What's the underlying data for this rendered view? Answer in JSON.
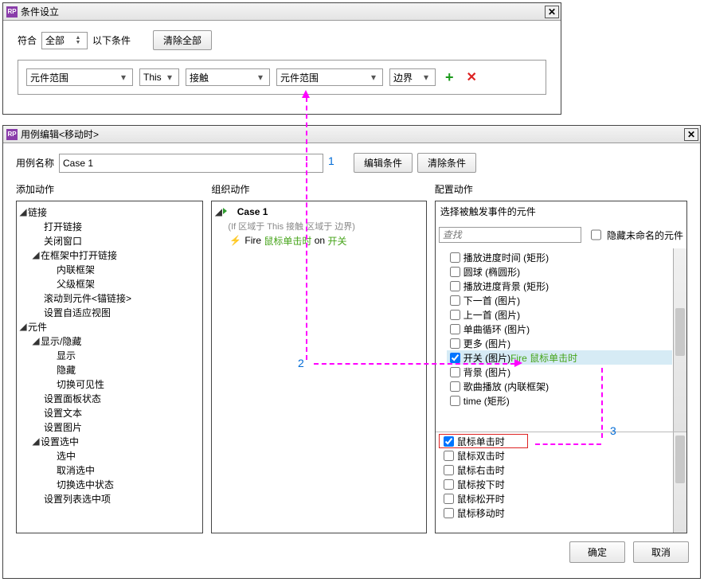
{
  "dlg1": {
    "title": "条件设立",
    "match_label": "符合",
    "match_combo": "全部",
    "match_suffix": "以下条件",
    "clear_all": "清除全部",
    "row": {
      "c1": "元件范围",
      "c2": "This",
      "c3": "接触",
      "c4": "元件范围",
      "c5": "边界"
    }
  },
  "callouts": {
    "n1": "1",
    "n2": "2",
    "n3": "3"
  },
  "dlg2": {
    "title": "用例编辑<移动时>",
    "name_label": "用例名称",
    "name_value": "Case 1",
    "edit_cond": "编辑条件",
    "clear_cond": "清除条件",
    "col_add": "添加动作",
    "col_org": "组织动作",
    "col_conf": "配置动作",
    "add_actions": {
      "links": {
        "h": "链接",
        "open_link": "打开链接",
        "close_win": "关闭窗口",
        "open_in_frame": "在框架中打开链接",
        "inner_frame": "内联框架",
        "parent_frame": "父级框架",
        "scroll_anchor": "滚动到元件<锚链接>",
        "set_adaptive": "设置自适应视图"
      },
      "widgets": {
        "h": "元件",
        "show_hide": "显示/隐藏",
        "show": "显示",
        "hide": "隐藏",
        "toggle_vis": "切换可见性",
        "panel_state": "设置面板状态",
        "set_text": "设置文本",
        "set_img": "设置图片",
        "set_sel": "设置选中",
        "sel_on": "选中",
        "sel_off": "取消选中",
        "sel_toggle": "切换选中状态",
        "list_sel": "设置列表选中项"
      }
    },
    "org": {
      "case_name": "Case 1",
      "cond_text": "(If 区域于 This 接触 区域于 边界)",
      "action_prefix": "Fire",
      "action_event": "鼠标单击时",
      "action_on": "on",
      "action_target": "开关"
    },
    "config": {
      "select_label": "选择被触发事件的元件",
      "search_ph": "查找",
      "hide_unnamed": "隐藏未命名的元件",
      "widgets": [
        {
          "label": "播放进度时间 (矩形)"
        },
        {
          "label": "圆球 (椭圆形)"
        },
        {
          "label": "播放进度背景 (矩形)"
        },
        {
          "label": "下一首 (图片)"
        },
        {
          "label": "上一首 (图片)"
        },
        {
          "label": "单曲循环 (图片)"
        },
        {
          "label": "更多 (图片)"
        },
        {
          "label": "开关 (图片)",
          "ann": "Fire 鼠标单击时",
          "selected": true,
          "checked": true
        },
        {
          "label": "背景 (图片)"
        },
        {
          "label": "歌曲播放 (内联框架)"
        },
        {
          "label": "time (矩形)"
        }
      ],
      "events": [
        {
          "label": "鼠标单击时",
          "checked": true,
          "hi": true
        },
        {
          "label": "鼠标双击时"
        },
        {
          "label": "鼠标右击时"
        },
        {
          "label": "鼠标按下时"
        },
        {
          "label": "鼠标松开时"
        },
        {
          "label": "鼠标移动时"
        }
      ]
    },
    "ok": "确定",
    "cancel": "取消"
  }
}
